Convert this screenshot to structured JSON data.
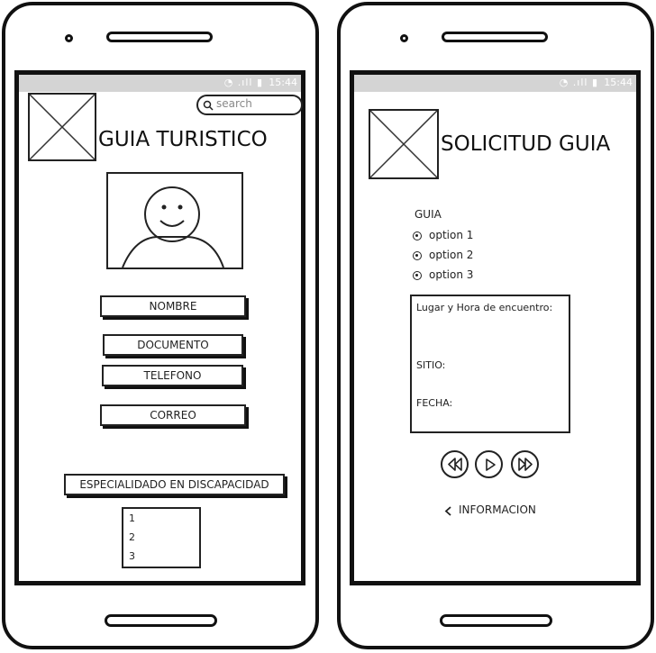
{
  "status_bar": {
    "time": "15:44",
    "icons": "wifi-icon signal-icon battery-icon"
  },
  "left_screen": {
    "title": "GUIA TURISTICO",
    "search": {
      "placeholder": "search",
      "icon": "search-icon"
    },
    "fields": {
      "nombre": "NOMBRE",
      "documento": "DOCUMENTO",
      "telefono": "TELEFONO",
      "correo": "CORREO",
      "especialidad": "ESPECIALIDADO EN DISCAPACIDAD"
    },
    "list_items": [
      "1",
      "2",
      "3"
    ]
  },
  "right_screen": {
    "title": "SOLICITUD GUIA",
    "guia_label": "GUIA",
    "options": [
      "option 1",
      "option 2",
      "option 3"
    ],
    "meeting": {
      "label": "Lugar y Hora de encuentro:",
      "sitio": "SITIO:",
      "fecha": "FECHA:"
    },
    "media_controls": [
      "rewind-icon",
      "play-icon",
      "fast-forward-icon"
    ],
    "back_link": "INFORMACION"
  }
}
